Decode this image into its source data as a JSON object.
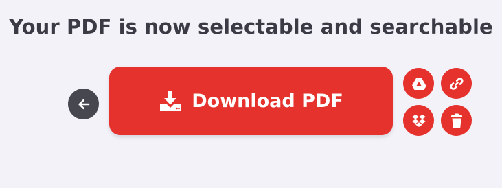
{
  "page": {
    "heading": "Your PDF is now selectable and searchable"
  },
  "actions": {
    "back": {
      "icon": "arrow-left-icon"
    },
    "download": {
      "label": "Download PDF",
      "icon": "download-icon"
    },
    "save_to_drive": {
      "icon": "google-drive-icon"
    },
    "copy_link": {
      "icon": "link-icon"
    },
    "save_to_dropbox": {
      "icon": "dropbox-icon"
    },
    "delete": {
      "icon": "trash-icon"
    }
  },
  "colors": {
    "background": "#f3f2f9",
    "accent": "#e5322d",
    "back_button": "#46474f",
    "heading_text": "#3a3b45"
  }
}
